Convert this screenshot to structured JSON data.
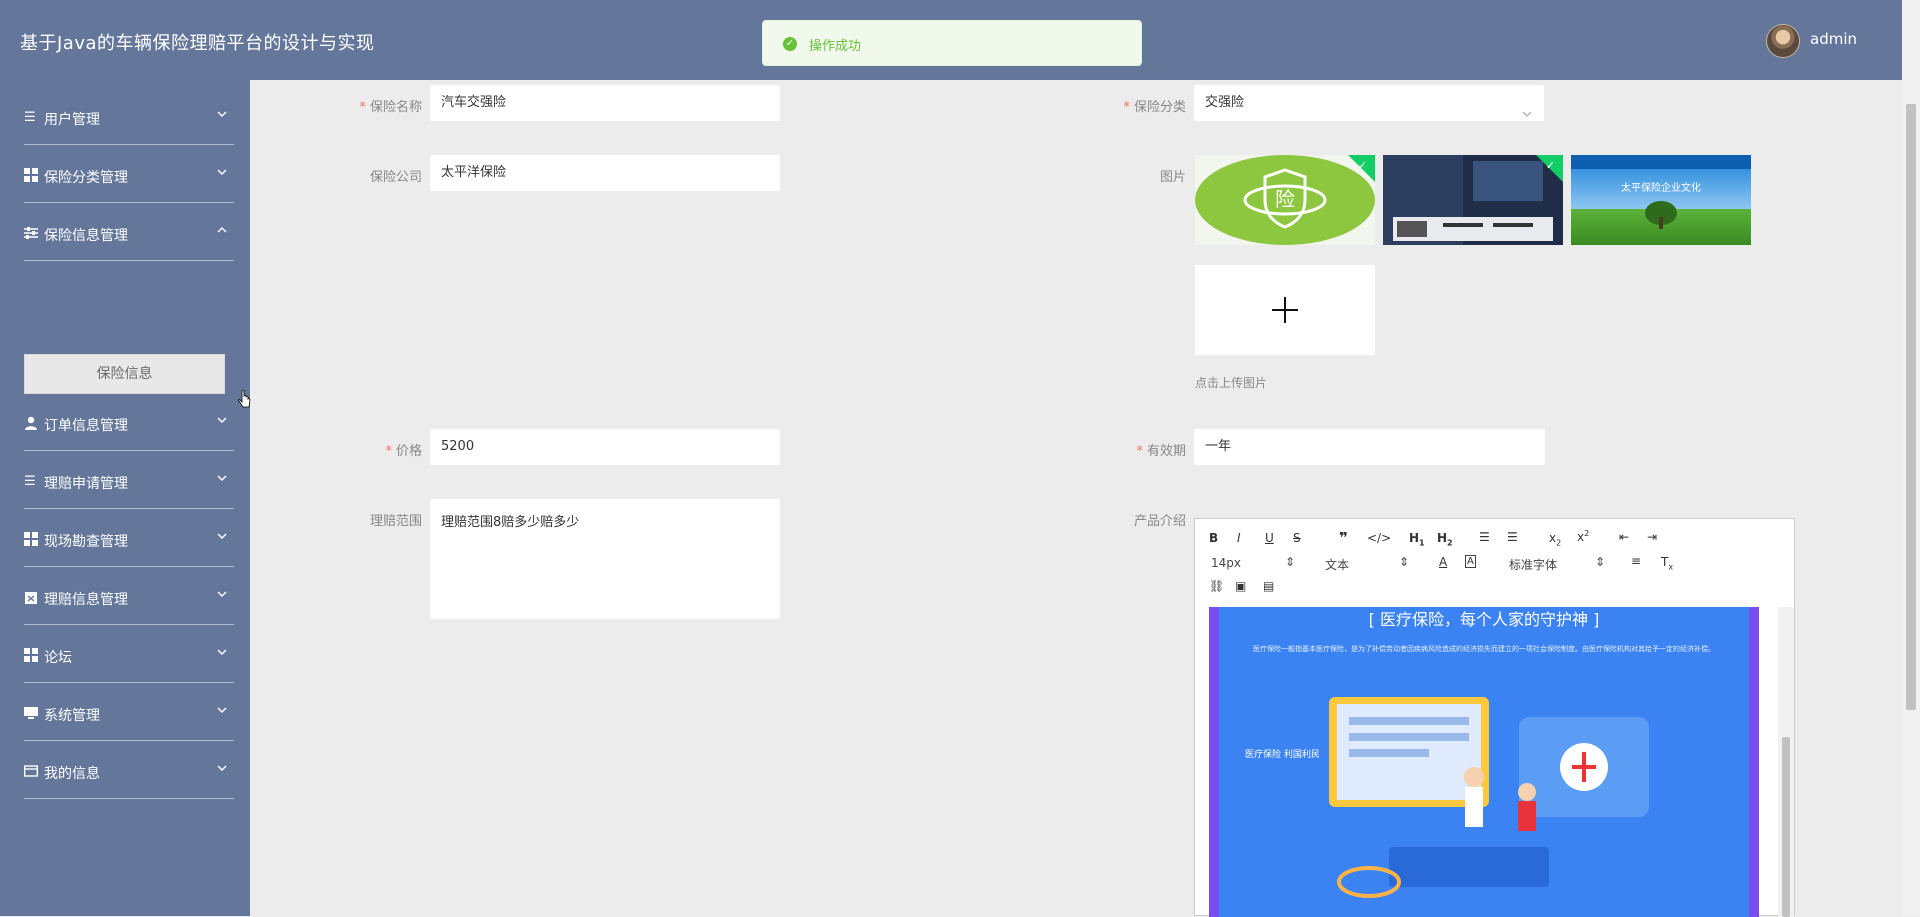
{
  "header": {
    "title": "基于Java的车辆保险理赔平台的设计与实现",
    "username": "admin"
  },
  "toast": {
    "text": "操作成功",
    "color": "#67c23a"
  },
  "sidebar": {
    "items": [
      {
        "label": "用户管理",
        "icon": "list-icon"
      },
      {
        "label": "保险分类管理",
        "icon": "grid-icon"
      },
      {
        "label": "保险信息管理",
        "icon": "sliders-icon",
        "expanded": true,
        "subitems": [
          "保险信息"
        ]
      },
      {
        "label": "订单信息管理",
        "icon": "user-icon"
      },
      {
        "label": "理赔申请管理",
        "icon": "list-icon"
      },
      {
        "label": "现场勘查管理",
        "icon": "grid-icon"
      },
      {
        "label": "理赔信息管理",
        "icon": "clipboard-icon"
      },
      {
        "label": "论坛",
        "icon": "grid-icon"
      },
      {
        "label": "系统管理",
        "icon": "monitor-icon"
      },
      {
        "label": "我的信息",
        "icon": "card-icon"
      }
    ]
  },
  "form": {
    "name": {
      "label": "保险名称",
      "value": "汽车交强险"
    },
    "category": {
      "label": "保险分类",
      "value": "交强险"
    },
    "company": {
      "label": "保险公司",
      "value": "太平洋保险"
    },
    "images": {
      "label": "图片",
      "upload_hint": "点击上传图片"
    },
    "price": {
      "label": "价格",
      "value": "5200"
    },
    "validity": {
      "label": "有效期",
      "value": "一年"
    },
    "scope": {
      "label": "理赔范围",
      "value": "理赔范围8赔多少赔多少"
    },
    "intro": {
      "label": "产品介绍"
    }
  },
  "editor": {
    "font_size": "14px",
    "block_type": "文本",
    "font_family": "标准字体",
    "banner_title": "[ 医疗保险，每个人家的守护神 ]",
    "banner_text": "医疗保险一般指基本医疗保险，是为了补偿劳动者因疾病风险造成的经济损失而建立的一项社会保险制度。由医疗保险机构对其给予一定的经济补偿。",
    "side_text": "医疗保险 利国利民"
  },
  "images_thumbs": [
    {
      "kind": "green-logo",
      "text": "险"
    },
    {
      "kind": "dark-poster"
    },
    {
      "kind": "culture",
      "text": "太平保险企业文化"
    }
  ]
}
